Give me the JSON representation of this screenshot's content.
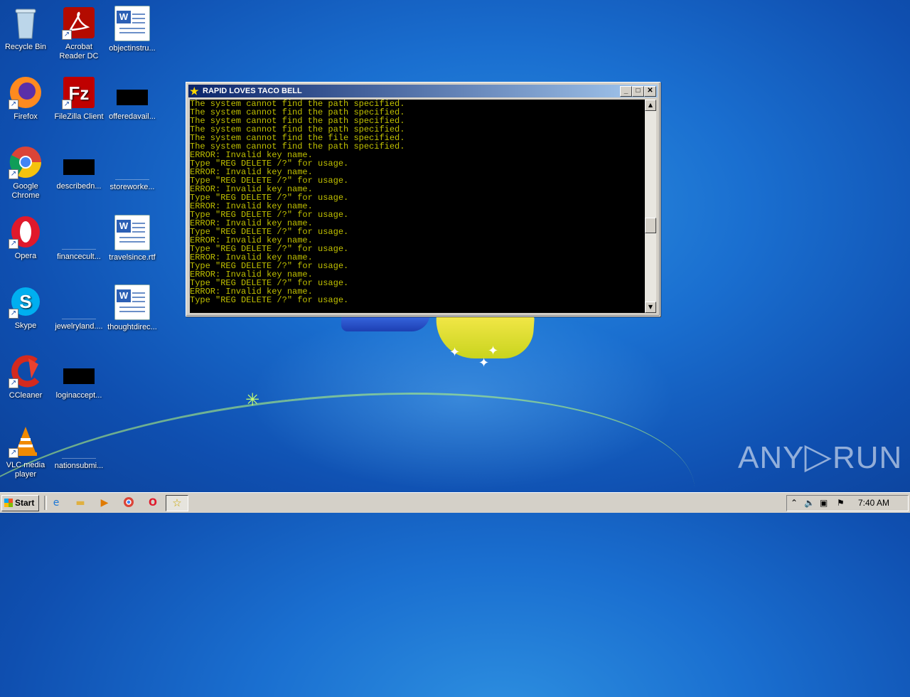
{
  "desktop": {
    "icons": [
      {
        "label": "Recycle Bin"
      },
      {
        "label": "Acrobat Reader DC"
      },
      {
        "label": "objectinstru..."
      },
      {
        "label": "Firefox"
      },
      {
        "label": "FileZilla Client"
      },
      {
        "label": "offeredavail..."
      },
      {
        "label": "Google Chrome"
      },
      {
        "label": "describedn..."
      },
      {
        "label": "storeworke..."
      },
      {
        "label": "Opera"
      },
      {
        "label": "financecult..."
      },
      {
        "label": "travelsince.rtf"
      },
      {
        "label": "Skype"
      },
      {
        "label": "jewelryland...."
      },
      {
        "label": "thoughtdirec..."
      },
      {
        "label": "CCleaner"
      },
      {
        "label": "loginaccept..."
      },
      {
        "label": "VLC media player"
      },
      {
        "label": "nationsubmi..."
      }
    ]
  },
  "console": {
    "title": "RAPID LOVES TACO BELL",
    "buttons": {
      "minimize": "_",
      "maximize": "□",
      "close": "✕"
    },
    "output": "The system cannot find the path specified.\nThe system cannot find the path specified.\nThe system cannot find the path specified.\nThe system cannot find the path specified.\nThe system cannot find the file specified.\nThe system cannot find the path specified.\nERROR: Invalid key name.\nType \"REG DELETE /?\" for usage.\nERROR: Invalid key name.\nType \"REG DELETE /?\" for usage.\nERROR: Invalid key name.\nType \"REG DELETE /?\" for usage.\nERROR: Invalid key name.\nType \"REG DELETE /?\" for usage.\nERROR: Invalid key name.\nType \"REG DELETE /?\" for usage.\nERROR: Invalid key name.\nType \"REG DELETE /?\" for usage.\nERROR: Invalid key name.\nType \"REG DELETE /?\" for usage.\nERROR: Invalid key name.\nType \"REG DELETE /?\" for usage.\nERROR: Invalid key name.\nType \"REG DELETE /?\" for usage.",
    "text_color": "#c0c000"
  },
  "watermark": {
    "left": "ANY",
    "right": "RUN"
  },
  "taskbar": {
    "start_label": "Start",
    "quick_launch": [
      "ie-icon",
      "explorer-icon",
      "media-player-icon",
      "chrome-icon",
      "opera-icon"
    ],
    "active_item_icon": "star-icon",
    "clock": "7:40 AM"
  }
}
